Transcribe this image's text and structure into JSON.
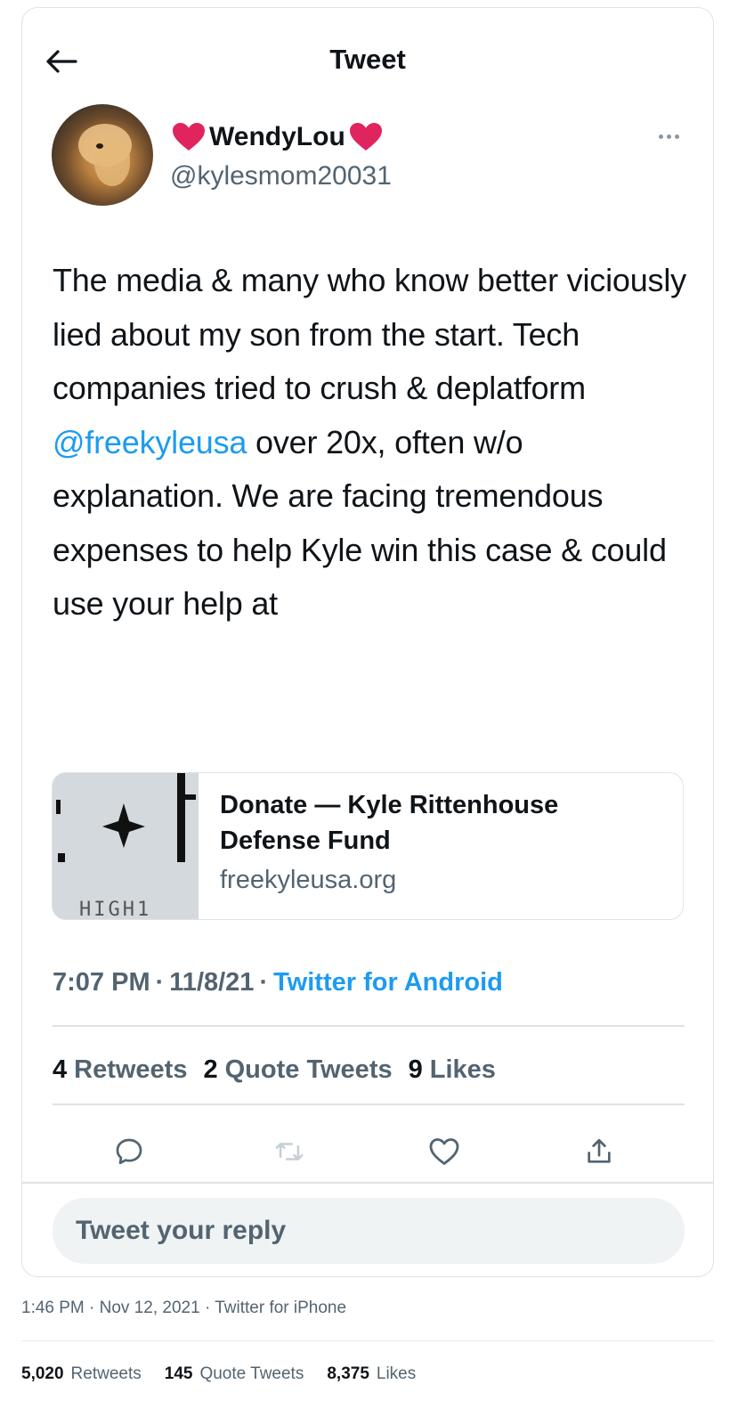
{
  "header": {
    "title": "Tweet"
  },
  "author": {
    "display_name": "WendyLou",
    "handle": "@kylesmom20031"
  },
  "tweet": {
    "text_before": "The media & many who know better viciously lied about my son from the start. Tech companies tried to crush & deplatform ",
    "mention": "@freekyleusa",
    "text_after": " over 20x, often w/o explanation. We are facing tremendous expenses to help Kyle win this case & could use your help at",
    "time": "7:07 PM",
    "date": "11/8/21",
    "source": "Twitter for Android"
  },
  "link_card": {
    "title": "Donate — Kyle Rittenhouse Defense Fund",
    "domain": "freekyleusa.org",
    "thumb_text": "HIGH1"
  },
  "stats": {
    "retweets_count": "4",
    "retweets_label": "Retweets",
    "quotes_count": "2",
    "quotes_label": "Quote Tweets",
    "likes_count": "9",
    "likes_label": "Likes"
  },
  "reply": {
    "placeholder": "Tweet your reply"
  },
  "outer": {
    "meta": "1:46 PM · Nov 12, 2021 · Twitter for iPhone",
    "retweets_count": "5,020",
    "retweets_label": "Retweets",
    "quotes_count": "145",
    "quotes_label": "Quote Tweets",
    "likes_count": "8,375",
    "likes_label": "Likes"
  },
  "icons": {
    "back": "arrow-left-icon",
    "more": "more-dots-icon",
    "heart_emoji": "red-heart-icon",
    "reply": "reply-icon",
    "retweet": "retweet-icon",
    "like": "like-icon",
    "share": "share-icon"
  },
  "colors": {
    "accent": "#1d9bf0",
    "text": "#0f1419",
    "muted": "#536471",
    "border": "#dfe3e6",
    "heart": "#e0245e"
  }
}
